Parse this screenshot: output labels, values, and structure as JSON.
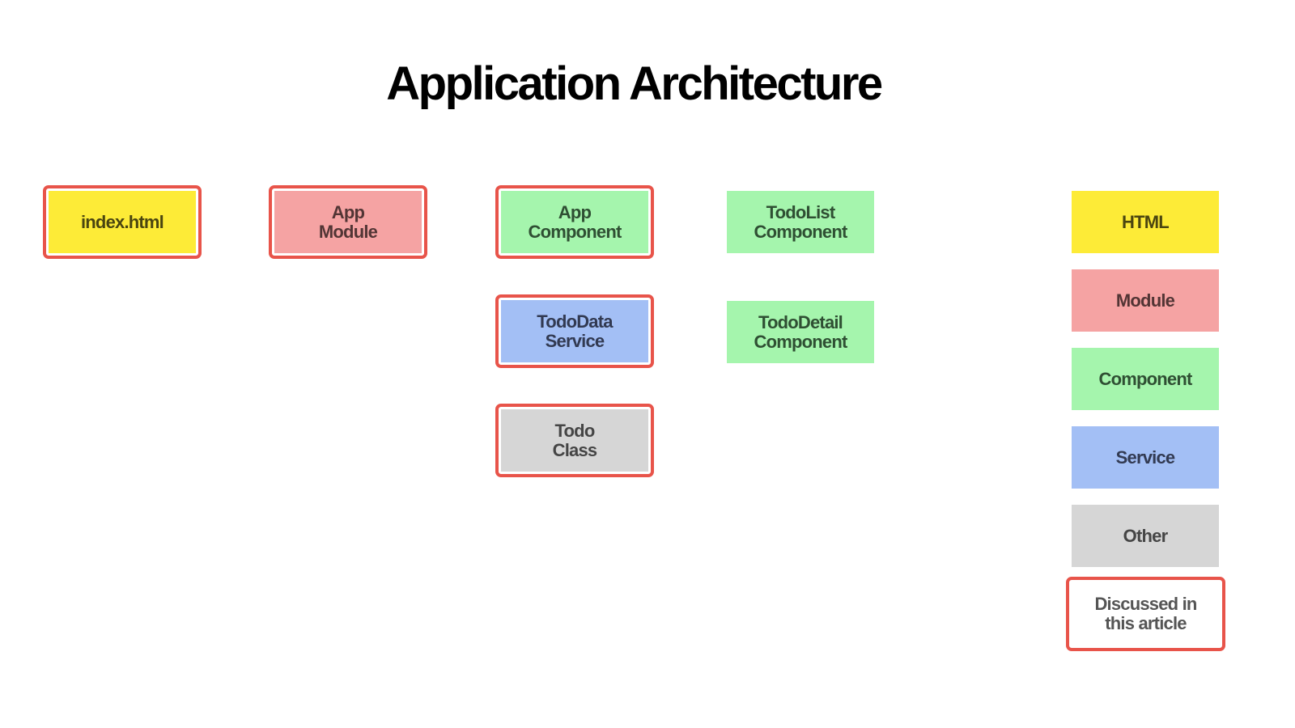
{
  "title": "Application Architecture",
  "colors": {
    "html": "#fdeb37",
    "module": "#f5a3a3",
    "component": "#a5f5ad",
    "service": "#a3bff5",
    "other": "#d6d6d6",
    "highlight_border": "#e8544a"
  },
  "text_colors": {
    "html": "#4a4510",
    "module": "#523535",
    "component": "#2f4f33",
    "service": "#323a52",
    "other": "#454545",
    "discussed": "#555555"
  },
  "nodes": [
    {
      "id": "index-html",
      "label": "index.html",
      "type": "html",
      "discussed": true
    },
    {
      "id": "app-module",
      "label": "App\nModule",
      "type": "module",
      "discussed": true
    },
    {
      "id": "app-component",
      "label": "App\nComponent",
      "type": "component",
      "discussed": true
    },
    {
      "id": "todolist-component",
      "label": "TodoList\nComponent",
      "type": "component",
      "discussed": false
    },
    {
      "id": "tododata-service",
      "label": "TodoData\nService",
      "type": "service",
      "discussed": true
    },
    {
      "id": "tododetail-component",
      "label": "TodoDetail\nComponent",
      "type": "component",
      "discussed": false
    },
    {
      "id": "todo-class",
      "label": "Todo\nClass",
      "type": "other",
      "discussed": true
    }
  ],
  "legend": [
    {
      "label": "HTML",
      "type": "html"
    },
    {
      "label": "Module",
      "type": "module"
    },
    {
      "label": "Component",
      "type": "component"
    },
    {
      "label": "Service",
      "type": "service"
    },
    {
      "label": "Other",
      "type": "other"
    },
    {
      "label": "Discussed in\nthis article",
      "type": "discussed"
    }
  ]
}
